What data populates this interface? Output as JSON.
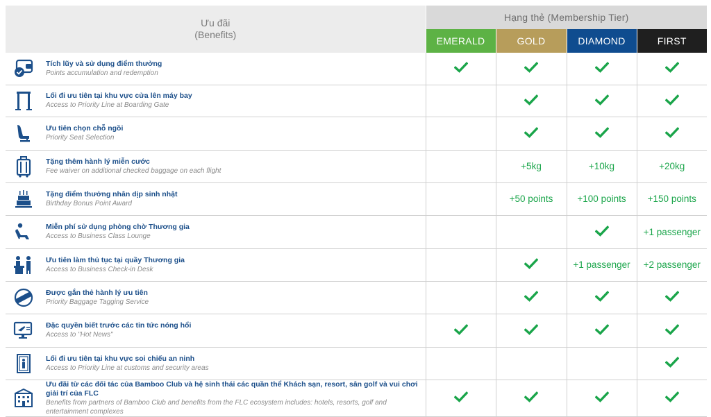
{
  "header": {
    "benefits_vn": "Ưu đãi",
    "benefits_en": "(Benefits)",
    "tier_title": "Hạng thẻ (Membership Tier)"
  },
  "tiers": [
    {
      "label": "EMERALD",
      "color": "#5db245"
    },
    {
      "label": "GOLD",
      "color": "#b79d5b"
    },
    {
      "label": "DIAMOND",
      "color": "#0f4c8f"
    },
    {
      "label": "FIRST",
      "color": "#1f1f1f"
    }
  ],
  "colors": {
    "check": "#1aa54a",
    "vn_text": "#1c4f8a",
    "icon": "#1c4f8a"
  },
  "rows": [
    {
      "icon": "wallet-icon",
      "vn": "Tích lũy và sử dụng điểm thưởng",
      "en": "Points accumulation and redemption",
      "cells": [
        {
          "check": true
        },
        {
          "check": true
        },
        {
          "check": true
        },
        {
          "check": true
        }
      ]
    },
    {
      "icon": "priority-gate-icon",
      "vn": "Lối đi ưu tiên tại khu vực cửa lên máy bay",
      "en": "Access to Priority Line at Boarding Gate",
      "cells": [
        {},
        {
          "check": true
        },
        {
          "check": true
        },
        {
          "check": true
        }
      ]
    },
    {
      "icon": "seat-icon",
      "vn": "Ưu tiên chọn chỗ ngồi",
      "en": "Priority Seat  Selection",
      "cells": [
        {},
        {
          "check": true
        },
        {
          "check": true
        },
        {
          "check": true
        }
      ]
    },
    {
      "icon": "luggage-icon",
      "vn": "Tặng thêm hành lý miễn cước",
      "en": "Fee waiver on additional checked baggage on each flight",
      "cells": [
        {},
        {
          "text": "+5kg"
        },
        {
          "text": "+10kg"
        },
        {
          "text": "+20kg"
        }
      ]
    },
    {
      "icon": "birthday-cake-icon",
      "vn": "Tặng điểm thưởng nhân dịp sinh nhật",
      "en": "Birthday Bonus Point Award",
      "cells": [
        {},
        {
          "text": "+50 points"
        },
        {
          "text": "+100 points"
        },
        {
          "text": "+150 points"
        }
      ]
    },
    {
      "icon": "lounge-icon",
      "vn": "Miễn phí sử dụng phòng chờ Thương gia",
      "en": "Access to Business Class Lounge",
      "cells": [
        {},
        {},
        {
          "check": true
        },
        {
          "text": "+1 passenger"
        }
      ]
    },
    {
      "icon": "checkin-desk-icon",
      "vn": "Ưu tiên làm thủ tục tại quầy Thương gia",
      "en": "Access to Business Check-in Desk",
      "cells": [
        {},
        {
          "check": true
        },
        {
          "text": "+1 passenger"
        },
        {
          "text": "+2 passenger"
        }
      ]
    },
    {
      "icon": "priority-tag-icon",
      "vn": "Được gắn thẻ hành lý ưu tiên",
      "en": "Priority Baggage Tagging Service",
      "cells": [
        {},
        {
          "check": true
        },
        {
          "check": true
        },
        {
          "check": true
        }
      ]
    },
    {
      "icon": "hot-news-icon",
      "vn": "Đặc quyền biết trước các tin tức nóng hổi",
      "en": "Access to \"Hot News\"",
      "cells": [
        {
          "check": true
        },
        {
          "check": true
        },
        {
          "check": true
        },
        {
          "check": true
        }
      ]
    },
    {
      "icon": "security-gate-icon",
      "vn": "Lối đi ưu tiên tại khu vực soi chiếu an ninh",
      "en": "Access to Priority Line at customs and security areas",
      "cells": [
        {},
        {},
        {},
        {
          "check": true
        }
      ]
    },
    {
      "icon": "partners-icon",
      "vn": "Ưu đãi từ các đối tác của Bamboo Club và hệ sinh thái các quần thể Khách sạn, resort, sân golf và vui chơi giải trí của FLC",
      "en": "Benefits from partners of Bamboo Club and benefits from the FLC ecosystem  includes:  hotels, resorts, golf and entertainment complexes",
      "cells": [
        {
          "check": true
        },
        {
          "check": true
        },
        {
          "check": true
        },
        {
          "check": true
        }
      ]
    }
  ]
}
